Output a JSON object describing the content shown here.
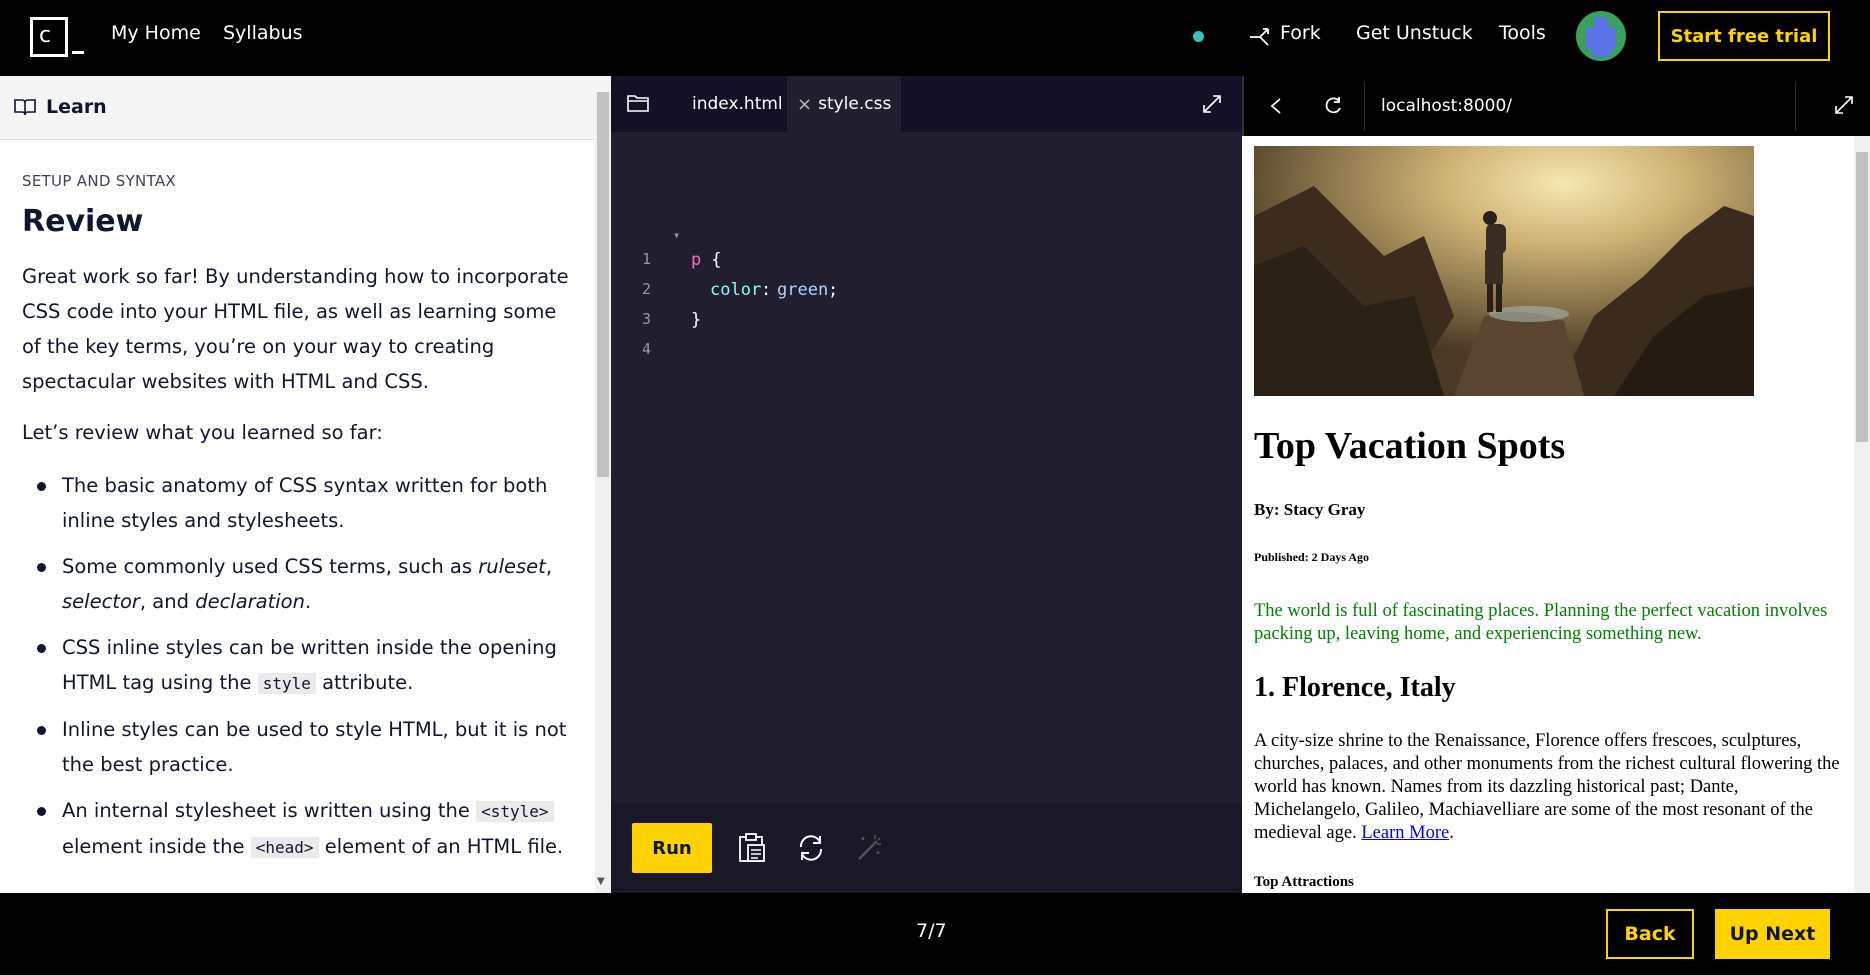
{
  "nav": {
    "links": [
      "My Home",
      "Syllabus"
    ],
    "fork": "Fork",
    "get_unstuck": "Get Unstuck",
    "tools": "Tools",
    "trial": "Start free trial",
    "status_color": "#37c3be",
    "accent": "#ffd300"
  },
  "learn": {
    "header": "Learn",
    "eyebrow": "SETUP AND SYNTAX",
    "title": "Review",
    "para1": "Great work so far! By understanding how to incorporate CSS code into your HTML file, as well as learning some of the key terms, you’re on your way to creating spectacular websites with HTML and CSS.",
    "para2": "Let’s review what you learned so far:",
    "bullets": {
      "b1": "The basic anatomy of CSS syntax written for both inline styles and stylesheets.",
      "b2_pre": "Some commonly used CSS terms, such as ",
      "b2_i1": "ruleset",
      "b2_c1": ", ",
      "b2_i2": "selector",
      "b2_c2": ", and ",
      "b2_i3": "declaration",
      "b2_end": ".",
      "b3_pre": "CSS inline styles can be written inside the opening HTML tag using the ",
      "b3_code": "style",
      "b3_end": " attribute.",
      "b4": "Inline styles can be used to style HTML, but it is not the best practice.",
      "b5_pre": "An internal stylesheet is written using the ",
      "b5_code1": "<style>",
      "b5_mid": " element inside the ",
      "b5_code2": "<head>",
      "b5_end": " element of an HTML file."
    }
  },
  "editor": {
    "tabs": [
      "index.html",
      "style.css"
    ],
    "close_glyph": "×",
    "lines": [
      {
        "num": "1",
        "fold": "▾",
        "sel": "p",
        "rest": " {"
      },
      {
        "num": "2",
        "prop": "color",
        "colon": ": ",
        "val": "green",
        "semi": ";"
      },
      {
        "num": "3",
        "text": "}"
      },
      {
        "num": "4",
        "text": ""
      }
    ],
    "run": "Run"
  },
  "browser": {
    "url": "localhost:8000/",
    "page": {
      "h1": "Top Vacation Spots",
      "byline": "By: Stacy Gray",
      "published": "Published: 2 Days Ago",
      "intro": "The world is full of fascinating places. Planning the perfect vacation involves packing up, leaving home, and experiencing something new.",
      "h2": "1. Florence, Italy",
      "body": "A city-size shrine to the Renaissance, Florence offers frescoes, sculptures, churches, palaces, and other monuments from the richest cultural flowering the world has known. Names from its dazzling historical past; Dante, Michelangelo, Galileo, Machiavelliare are some of the most resonant of the medieval age. ",
      "link": "Learn More",
      "body_end": ".",
      "attractions": "Top Attractions"
    }
  },
  "footer": {
    "count": "7/7",
    "back": "Back",
    "next": "Up Next"
  }
}
